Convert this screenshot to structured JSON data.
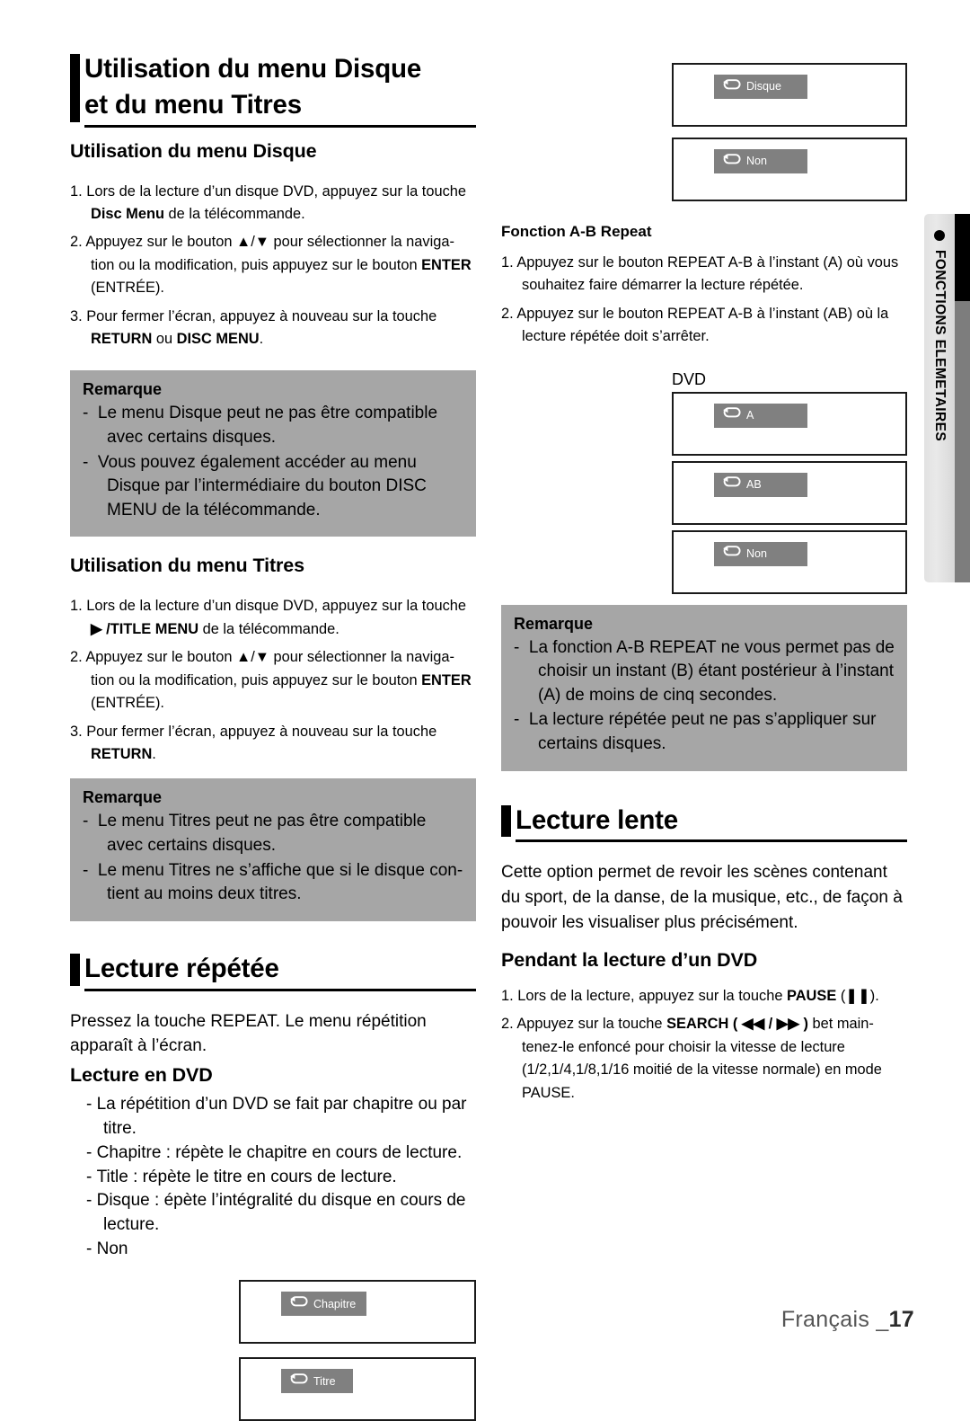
{
  "sidetab": {
    "label": "FONCTIONS ELEMETAIRES",
    "dot": "bullet-dot"
  },
  "footer": {
    "language": "Français _",
    "page": "17"
  },
  "left_column": {
    "title_line1": "Utilisation du menu Disque",
    "title_line2": "et du menu Titres",
    "section_disc_menu": {
      "heading": "Utilisation du menu Disque",
      "steps": [
        {
          "num": "1.",
          "parts": [
            {
              "t": "Lors de la lecture d’un disque DVD, appuyez sur la touche ",
              "b": false
            },
            {
              "t": "Disc  Menu",
              "b": true
            },
            {
              "t": " de la télécommande.",
              "b": false
            }
          ]
        },
        {
          "num": "2.",
          "parts": [
            {
              "t": "Appuyez sur le bouton ▲/▼ pour sélectionner la naviga-tion ou la modification, puis appuyez sur le bouton ",
              "b": false
            },
            {
              "t": "ENTER",
              "b": true
            },
            {
              "t": " (ENTRÉE).",
              "b": false
            }
          ]
        },
        {
          "num": "3.",
          "parts": [
            {
              "t": "Pour fermer l’écran, appuyez à nouveau sur la touche ",
              "b": false
            },
            {
              "t": "RETURN",
              "b": true
            },
            {
              "t": " ou ",
              "b": false
            },
            {
              "t": "DISC MENU",
              "b": true
            },
            {
              "t": ".",
              "b": false
            }
          ]
        }
      ],
      "remarque": {
        "title": "Remarque",
        "items": [
          "Le menu Disque peut ne pas être compatible avec certains disques.",
          "Vous pouvez également accéder au menu Disque par l’intermédiaire du bouton DISC MENU de la télécommande."
        ]
      }
    },
    "section_title_menu": {
      "heading": "Utilisation du menu Titres",
      "steps": [
        {
          "num": "1.",
          "parts": [
            {
              "t": "Lors de la lecture d’un disque DVD, appuyez sur la touche ",
              "b": false
            },
            {
              "t": "▶ /TITLE MENU",
              "b": true
            },
            {
              "t": " de la télécommande.",
              "b": false
            }
          ]
        },
        {
          "num": "2.",
          "parts": [
            {
              "t": "Appuyez sur le bouton ▲/▼ pour sélectionner la naviga-tion ou la modification, puis appuyez sur le bouton ",
              "b": false
            },
            {
              "t": "ENTER",
              "b": true
            },
            {
              "t": " (ENTRÉE).",
              "b": false
            }
          ]
        },
        {
          "num": "3.",
          "parts": [
            {
              "t": "Pour fermer l’écran, appuyez à nouveau sur la touche ",
              "b": false
            },
            {
              "t": "RETURN",
              "b": true
            },
            {
              "t": ".",
              "b": false
            }
          ]
        }
      ],
      "remarque": {
        "title": "Remarque",
        "items": [
          "Le menu Titres peut ne pas être compatible avec certains disques.",
          "Le menu Titres ne s’affiche que si le disque con-tient au moins deux titres."
        ]
      }
    },
    "section_repeat": {
      "title": "Lecture répétée",
      "intro": "Pressez la touche REPEAT. Le menu répétition apparaît à l’écran.",
      "sub_heading": "Lecture en DVD",
      "bullets": [
        "La répétition d’un DVD se fait par chapitre ou par titre.",
        "Chapitre : répète le chapitre en cours de lecture.",
        "Title : répète le titre en cours de lecture.",
        "Disque : épète l’intégralité du disque en cours de lecture.",
        "Non"
      ],
      "osd_boxes": [
        {
          "label": "Chapitre",
          "icon": "repeat-icon"
        },
        {
          "label": "Titre",
          "icon": "repeat-icon"
        }
      ]
    }
  },
  "right_column": {
    "osd_boxes_top": [
      {
        "label": "Disque",
        "icon": "repeat-icon"
      },
      {
        "label": "Non",
        "icon": "repeat-icon"
      }
    ],
    "section_ab_repeat": {
      "heading": "Fonction A-B Repeat",
      "steps": [
        {
          "num": "1.",
          "text": "Appuyez sur le bouton REPEAT A-B à l’instant (A) où vous souhaitez faire démarrer la lecture répétée."
        },
        {
          "num": "2.",
          "text": "Appuyez sur le bouton REPEAT A-B à l’instant (AB) où la lecture répétée doit s’arrêter."
        }
      ],
      "osd_caption": "DVD",
      "osd_boxes": [
        {
          "label": "A",
          "icon": "repeat-icon"
        },
        {
          "label": "AB",
          "icon": "repeat-icon"
        },
        {
          "label": "Non",
          "icon": "repeat-icon"
        }
      ],
      "remarque": {
        "title": "Remarque",
        "items": [
          "La fonction A-B REPEAT ne vous permet pas de choisir un instant (B) étant postérieur à l’instant (A) de moins de cinq secondes.",
          "La lecture répétée peut ne pas s’appliquer sur certains disques."
        ]
      }
    },
    "section_slow": {
      "title": "Lecture lente",
      "intro": "Cette option permet de revoir les scènes contenant du sport, de la danse, de la musique, etc., de façon à pouvoir les visualiser plus précisément.",
      "sub_heading": "Pendant la lecture d’un DVD",
      "steps": [
        {
          "num": "1.",
          "parts": [
            {
              "t": "Lors de la lecture, appuyez sur la touche ",
              "b": false
            },
            {
              "t": "PAUSE",
              "b": true
            },
            {
              "t": " (❚❚).",
              "b": false
            }
          ]
        },
        {
          "num": "2.",
          "parts": [
            {
              "t": "Appuyez sur la touche  ",
              "b": false
            },
            {
              "t": "SEARCH ( ◀◀ / ▶▶ )",
              "b": true
            },
            {
              "t": " bet main-tenez-le enfoncé pour choisir la vitesse de lecture (1/2,1/4,1/8,1/16 moitié de la vitesse normale) en mode PAUSE.",
              "b": false
            }
          ]
        }
      ]
    }
  },
  "colors": {
    "remarque_bg": "#a6a6a6",
    "chip_bg": "#808080",
    "sidetab_black": "#000000",
    "sidetab_gray": "#7d7d7d"
  }
}
